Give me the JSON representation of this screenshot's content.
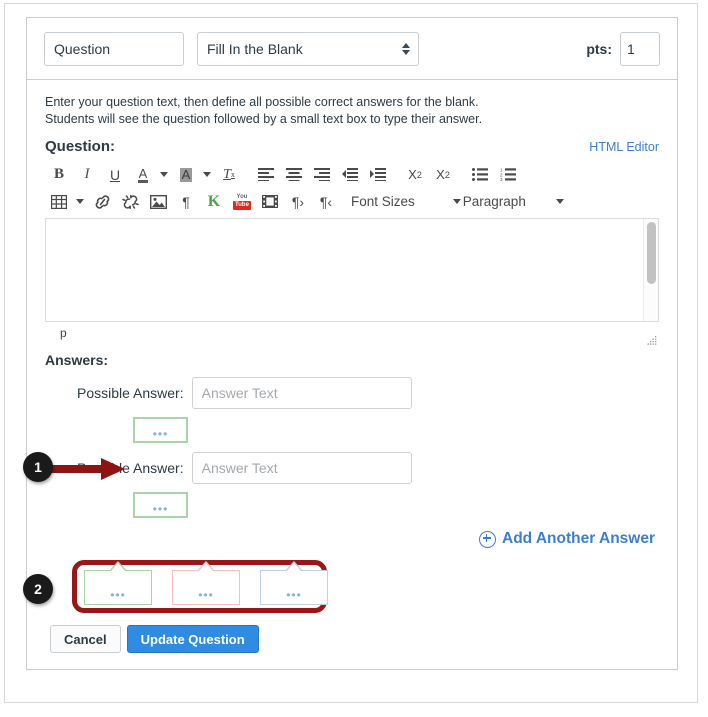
{
  "header": {
    "question_name_value": "Question",
    "question_name_placeholder": "Question",
    "question_type_value": "Fill In the Blank",
    "pts_label": "pts:",
    "pts_value": "1"
  },
  "instructions": {
    "line1": "Enter your question text, then define all possible correct answers for the blank.",
    "line2": "Students will see the question followed by a small text box to type their answer."
  },
  "question_section": {
    "label": "Question:",
    "html_editor_link": "HTML Editor"
  },
  "toolbar": {
    "row1": [
      {
        "name": "bold-icon",
        "label": "B"
      },
      {
        "name": "italic-icon",
        "label": "I"
      },
      {
        "name": "underline-icon",
        "label": "U"
      },
      {
        "name": "text-color-icon",
        "label": "A"
      },
      {
        "name": "highlight-color-icon",
        "label": "A"
      },
      {
        "name": "clear-formatting-icon",
        "label": "T"
      },
      {
        "name": "align-left-icon",
        "label": ""
      },
      {
        "name": "align-center-icon",
        "label": ""
      },
      {
        "name": "align-right-icon",
        "label": ""
      },
      {
        "name": "outdent-icon",
        "label": ""
      },
      {
        "name": "indent-icon",
        "label": ""
      },
      {
        "name": "superscript-icon",
        "label": "x"
      },
      {
        "name": "subscript-icon",
        "label": "x"
      },
      {
        "name": "bullet-list-icon",
        "label": ""
      },
      {
        "name": "numbered-list-icon",
        "label": ""
      }
    ],
    "row2": [
      {
        "name": "table-icon",
        "label": ""
      },
      {
        "name": "link-icon",
        "label": ""
      },
      {
        "name": "unlink-icon",
        "label": ""
      },
      {
        "name": "image-icon",
        "label": ""
      },
      {
        "name": "paragraph-mark-icon",
        "label": "¶"
      },
      {
        "name": "kaltura-icon",
        "label": "K"
      },
      {
        "name": "youtube-icon",
        "label": "You Tube"
      },
      {
        "name": "media-film-icon",
        "label": ""
      },
      {
        "name": "ltr-direction-icon",
        "label": "¶"
      },
      {
        "name": "rtl-direction-icon",
        "label": "¶"
      }
    ],
    "youtube_top": "You",
    "youtube_bottom": "Tube",
    "font_sizes_label": "Font Sizes",
    "paragraph_label": "Paragraph"
  },
  "editor": {
    "content": "",
    "status_path": "p"
  },
  "answers": {
    "section_label": "Answers:",
    "items": [
      {
        "label": "Possible Answer:",
        "value": "",
        "placeholder": "Answer Text",
        "ghost_dots": "•••"
      },
      {
        "label": "Possible Answer:",
        "value": "",
        "placeholder": "Answer Text",
        "ghost_dots": "•••"
      }
    ],
    "add_another_label": "Add Another Answer"
  },
  "tooltip_group": {
    "tips": [
      {
        "name": "tooltip-green",
        "dots": "•••",
        "color": "#a8d5a8"
      },
      {
        "name": "tooltip-pink",
        "dots": "•••",
        "color": "#f2c2c2"
      },
      {
        "name": "tooltip-blue",
        "dots": "•••",
        "color": "#c2cfe8"
      }
    ]
  },
  "callouts": [
    {
      "number": "1"
    },
    {
      "number": "2"
    }
  ],
  "footer": {
    "cancel_label": "Cancel",
    "update_label": "Update Question"
  },
  "colors": {
    "link_blue": "#3b7fd4",
    "primary_button": "#2f8ce0",
    "callout_red": "#9b1616",
    "arrow_red": "#8e1414",
    "ghost_green": "#a8d5a8",
    "dots_blue": "#7fb3e8"
  }
}
